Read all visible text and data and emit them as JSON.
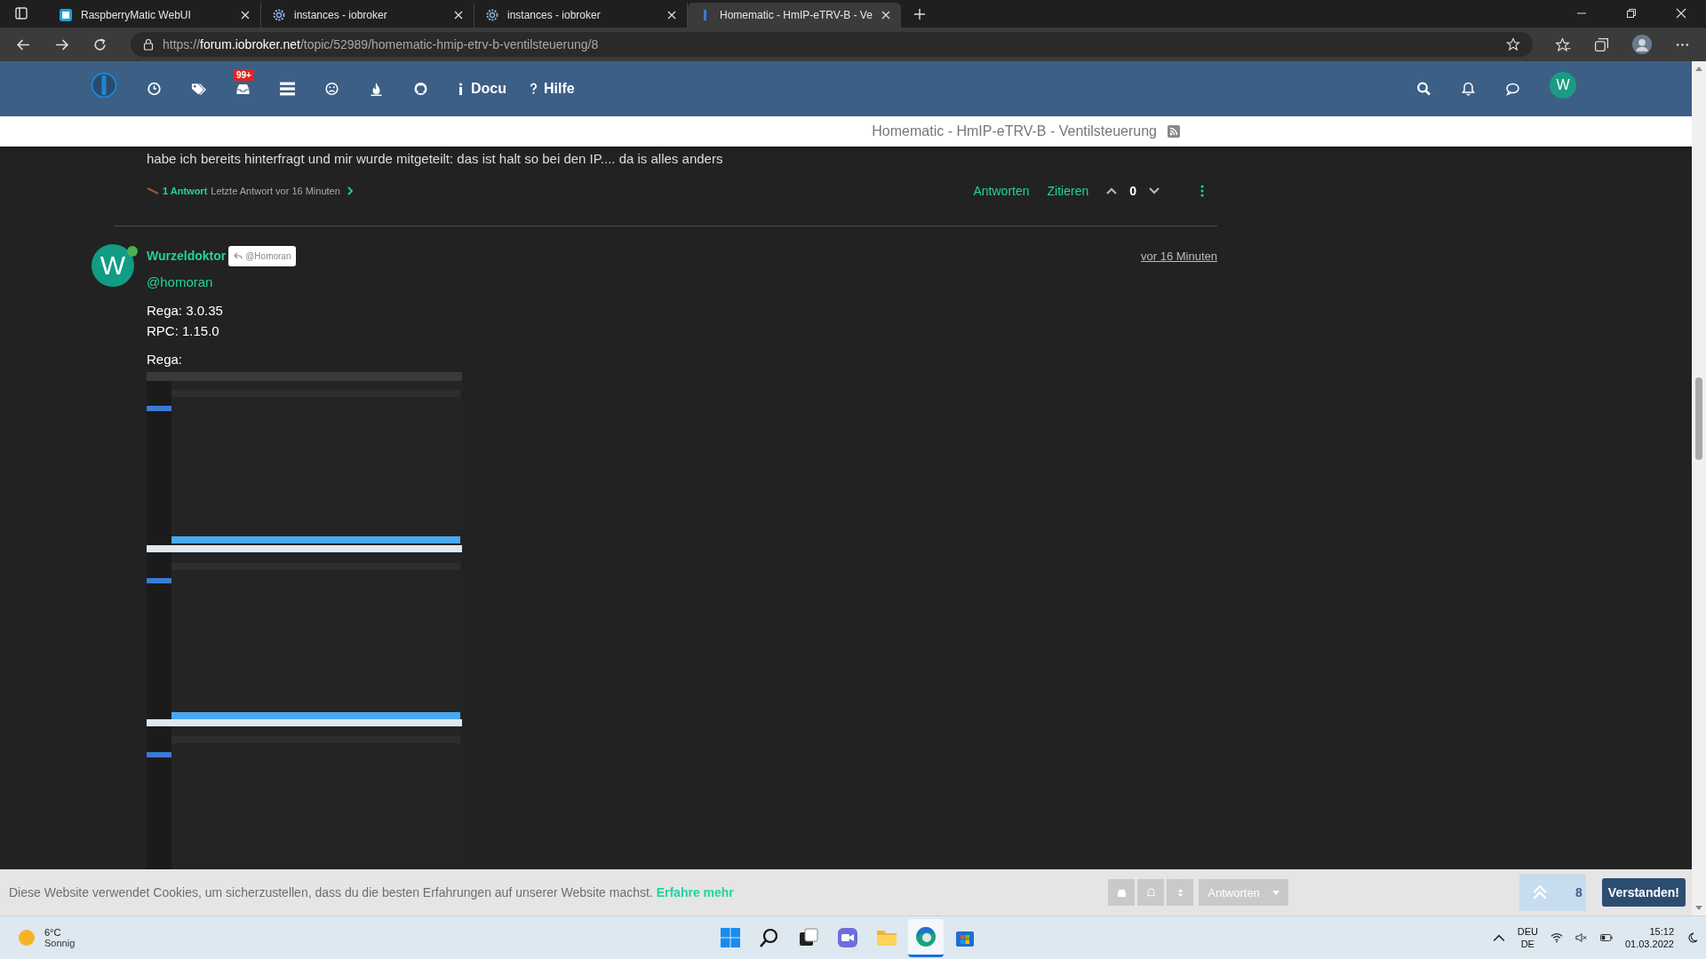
{
  "browser": {
    "tabs": [
      {
        "title": "RaspberryMatic WebUI",
        "selected": false,
        "kind": "raspberry"
      },
      {
        "title": "instances - iobroker",
        "selected": false,
        "kind": "gear"
      },
      {
        "title": "instances - iobroker",
        "selected": false,
        "kind": "gear"
      },
      {
        "title": "Homematic - HmIP-eTRV-B - Ve",
        "selected": true,
        "kind": "iobroker"
      }
    ],
    "url": {
      "scheme": "https://",
      "host": "forum.iobroker.net",
      "path": "/topic/52989/homematic-hmip-etrv-b-ventilsteuerung/8"
    }
  },
  "navbar": {
    "badge": "99+",
    "links": [
      "Docu",
      "Hilfe"
    ],
    "avatar": "W"
  },
  "breadcrumb": {
    "title": "Homematic - HmIP-eTRV-B - Ventilsteuerung"
  },
  "previous_post": {
    "text": "habe ich bereits hinterfragt und mir wurde mitgeteilt: das ist halt so bei den IP.... da is alles anders",
    "replies": "1 Antwort",
    "last_reply": "Letzte Antwort vor 16 Minuten",
    "actions": [
      "Antworten",
      "Zitieren"
    ],
    "votes": "0"
  },
  "post": {
    "avatar": "W",
    "online": true,
    "author": "Wurzeldoktor",
    "reply_to": "@Homoran",
    "time": "vor 16 Minuten",
    "mention": "@homoran",
    "lines": [
      "Rega: 3.0.35",
      "RPC: 1.15.0"
    ],
    "caption": "Rega:"
  },
  "cookie_bar": {
    "text": "Diese Website verwendet Cookies, um sicherzustellen, dass du die besten Erfahrungen auf unserer Website machst.",
    "link": "Erfahre mehr",
    "reply_button": "Antworten",
    "post_counter": "8",
    "accept": "Verstanden!"
  },
  "taskbar": {
    "temperature": "6°C",
    "weather": "Sonnig",
    "language": "DEU",
    "layout": "DE",
    "time": "15:12",
    "date": "01.03.2022"
  }
}
